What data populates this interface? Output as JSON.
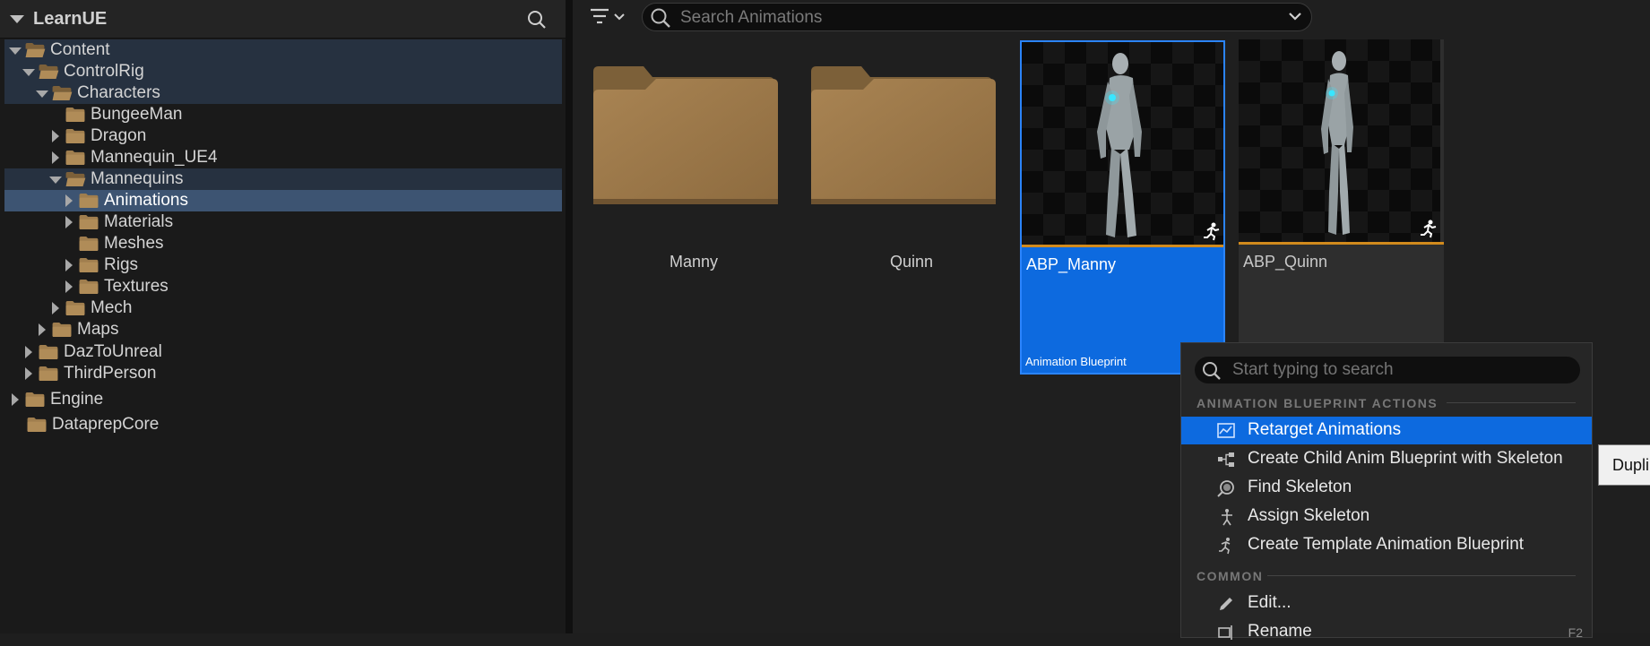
{
  "panel": {
    "title": "LearnUE"
  },
  "tree": [
    {
      "label": "Content",
      "depth": 0,
      "state": "open"
    },
    {
      "label": "ControlRig",
      "depth": 1,
      "state": "open"
    },
    {
      "label": "Characters",
      "depth": 2,
      "state": "open"
    },
    {
      "label": "BungeeMan",
      "depth": 4,
      "state": "none"
    },
    {
      "label": "Dragon",
      "depth": 3,
      "state": "closed"
    },
    {
      "label": "Mannequin_UE4",
      "depth": 3,
      "state": "closed"
    },
    {
      "label": "Mannequins",
      "depth": 3,
      "state": "open"
    },
    {
      "label": "Animations",
      "depth": 4,
      "state": "closed"
    },
    {
      "label": "Materials",
      "depth": 4,
      "state": "closed"
    },
    {
      "label": "Meshes",
      "depth": 5,
      "state": "none"
    },
    {
      "label": "Rigs",
      "depth": 4,
      "state": "closed"
    },
    {
      "label": "Textures",
      "depth": 4,
      "state": "closed"
    },
    {
      "label": "Mech",
      "depth": 3,
      "state": "closed"
    },
    {
      "label": "Maps",
      "depth": 2,
      "state": "closed"
    },
    {
      "label": "DazToUnreal",
      "depth": 1,
      "state": "closed"
    },
    {
      "label": "ThirdPerson",
      "depth": 1,
      "state": "closed"
    },
    {
      "label": "Engine",
      "depth": 0,
      "state": "closed"
    },
    {
      "label": "DataprepCore",
      "depth": 1,
      "state": "none"
    }
  ],
  "search": {
    "placeholder": "Search Animations"
  },
  "tiles": [
    {
      "name": "Manny",
      "kind": "folder"
    },
    {
      "name": "Quinn",
      "kind": "folder"
    },
    {
      "name": "ABP_Manny",
      "kind": "asset",
      "type": "Animation Blueprint"
    },
    {
      "name": "ABP_Quinn",
      "kind": "asset"
    }
  ],
  "menu": {
    "placeholder": "Start typing to search",
    "section1": "ANIMATION BLUEPRINT ACTIONS",
    "items1": [
      {
        "label": "Retarget Animations",
        "icon": "retarget-icon"
      },
      {
        "label": "Create Child Anim Blueprint with Skeleton",
        "icon": "child-blueprint-icon"
      },
      {
        "label": "Find Skeleton",
        "icon": "find-skeleton-icon"
      },
      {
        "label": "Assign Skeleton",
        "icon": "assign-skeleton-icon"
      },
      {
        "label": "Create Template Animation Blueprint",
        "icon": "template-icon"
      }
    ],
    "section2": "COMMON",
    "items2": [
      {
        "label": "Edit...",
        "icon": "pencil-icon"
      },
      {
        "label": "Rename",
        "icon": "rename-icon",
        "shortcut": "F2"
      }
    ]
  },
  "tooltip": {
    "text": "Dupli"
  },
  "colors": {
    "folder": "#a07e4e",
    "selection": "#0d6adf",
    "accent_line": "#d18a1d"
  }
}
